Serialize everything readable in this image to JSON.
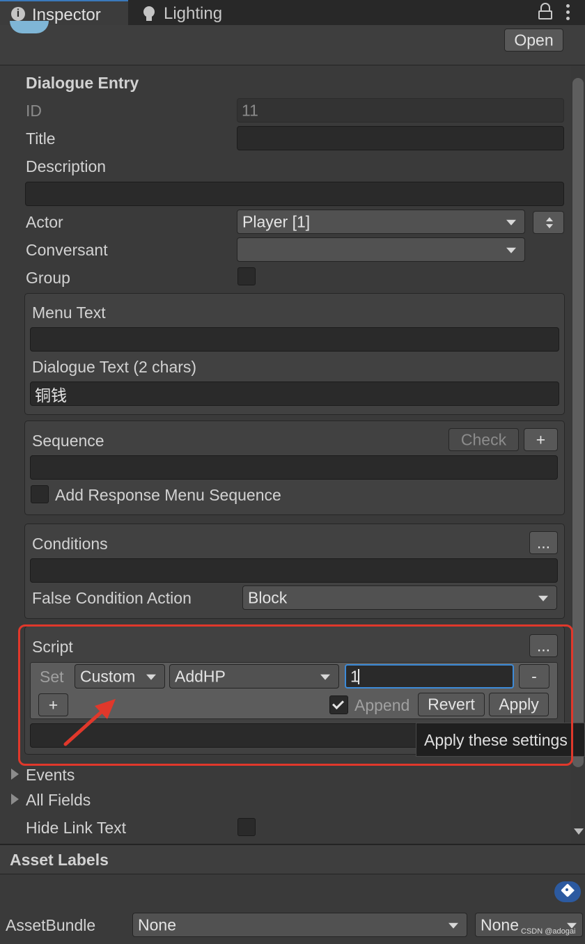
{
  "tabs": {
    "inspector": "Inspector",
    "lighting": "Lighting"
  },
  "header": {
    "open_label": "Open"
  },
  "entry": {
    "section_title": "Dialogue Entry",
    "id_label": "ID",
    "id_value": "11",
    "title_label": "Title",
    "title_value": "",
    "description_label": "Description",
    "description_value": "",
    "actor_label": "Actor",
    "actor_value": "Player [1]",
    "conversant_label": "Conversant",
    "conversant_value": "",
    "group_label": "Group"
  },
  "text_panel": {
    "menu_text_label": "Menu Text",
    "menu_text_value": "",
    "dialogue_text_label": "Dialogue Text (2 chars)",
    "dialogue_text_value": "铜钱"
  },
  "sequence_panel": {
    "label": "Sequence",
    "check_label": "Check",
    "plus_label": "+",
    "value": "",
    "add_response_label": "Add Response Menu Sequence"
  },
  "conditions_panel": {
    "label": "Conditions",
    "more_label": "...",
    "value": "",
    "false_action_label": "False Condition Action",
    "false_action_value": "Block"
  },
  "script_panel": {
    "label": "Script",
    "more_label": "...",
    "set_label": "Set",
    "type_value": "Custom",
    "function_value": "AddHP",
    "arg_value": "1",
    "minus_label": "-",
    "plus_label": "+",
    "append_label": "Append",
    "revert_label": "Revert",
    "apply_label": "Apply",
    "tooltip": "Apply these settings"
  },
  "foldouts": {
    "events": "Events",
    "all_fields": "All Fields"
  },
  "hide_link_text_label": "Hide Link Text",
  "asset_labels": {
    "title": "Asset Labels",
    "bundle_label": "AssetBundle",
    "bundle_value": "None",
    "variant_value": "None"
  },
  "watermark": "CSDN @adogai",
  "colors": {
    "highlight_box": "#e0382b",
    "arrow": "#e0382b",
    "tag_badge": "#2c5aa0",
    "input_focus": "#3d8bd8"
  }
}
